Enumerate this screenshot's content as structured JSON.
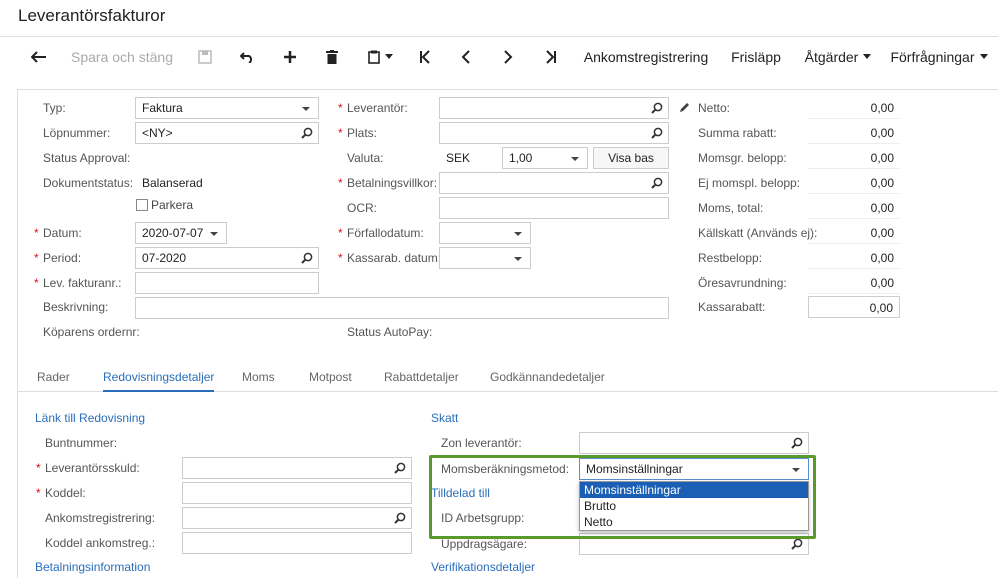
{
  "page": {
    "title": "Leverantörsfakturor"
  },
  "toolbar": {
    "save_close": "Spara och stäng",
    "receipt": "Ankomstregistrering",
    "release": "Frisläpp",
    "actions": "Åtgärder",
    "requests": "Förfrågningar"
  },
  "form": {
    "typ_label": "Typ:",
    "typ_value": "Faktura",
    "lopnr_label": "Löpnummer:",
    "lopnr_value": "<NY>",
    "status_approval_label": "Status Approval:",
    "docstatus_label": "Dokumentstatus:",
    "docstatus_value": "Balanserad",
    "parkera_label": "Parkera",
    "datum_label": "Datum:",
    "datum_value": "2020-07-07",
    "period_label": "Period:",
    "period_value": "07-2020",
    "levfakt_label": "Lev. fakturanr.:",
    "beskrivning_label": "Beskrivning:",
    "koparens_label": "Köparens ordernr:",
    "leverantor_label": "Leverantör:",
    "plats_label": "Plats:",
    "valuta_label": "Valuta:",
    "valuta_value": "SEK",
    "kurs_value": "1,00",
    "visa_bas": "Visa bas",
    "betvillkor_label": "Betalningsvillkor:",
    "ocr_label": "OCR:",
    "forfallo_label": "Förfallodatum:",
    "kassarab_label": "Kassarab. datum:",
    "status_autopay_label": "Status AutoPay:"
  },
  "totals": [
    {
      "label": "Netto:",
      "value": "0,00"
    },
    {
      "label": "Summa rabatt:",
      "value": "0,00"
    },
    {
      "label": "Momsgr. belopp:",
      "value": "0,00"
    },
    {
      "label": "Ej momspl. belopp:",
      "value": "0,00"
    },
    {
      "label": "Moms, total:",
      "value": "0,00"
    },
    {
      "label": "Källskatt (Används ej):",
      "value": "0,00"
    },
    {
      "label": "Restbelopp:",
      "value": "0,00"
    },
    {
      "label": "Öresavrundning:",
      "value": "0,00"
    },
    {
      "label": "Kassarabatt:",
      "value": "0,00"
    }
  ],
  "tabs": [
    "Rader",
    "Redovisningsdetaljer",
    "Moms",
    "Motpost",
    "Rabattdetaljer",
    "Godkännandedetaljer"
  ],
  "details": {
    "link_section": "Länk till Redovisning",
    "buntnummer_label": "Buntnummer:",
    "levskuld_label": "Leverantörsskuld:",
    "koddel_label": "Koddel:",
    "ankomst_label": "Ankomstregistrering:",
    "koddel_ankomst_label": "Koddel ankomstreg.:",
    "betinfo_section": "Betalningsinformation",
    "skatt_section": "Skatt",
    "zon_label": "Zon leverantör:",
    "momsmetod_label": "Momsberäkningsmetod:",
    "momsmetod_value": "Momsinställningar",
    "tilldelad_section": "Tilldelad till",
    "arbetsgrupp_label": "ID Arbetsgrupp:",
    "uppdrag_label": "Uppdragsägare:",
    "verif_section": "Verifikationsdetaljer"
  },
  "dropdown": {
    "options": [
      "Momsinställningar",
      "Brutto",
      "Netto"
    ],
    "selected": "Momsinställningar"
  }
}
